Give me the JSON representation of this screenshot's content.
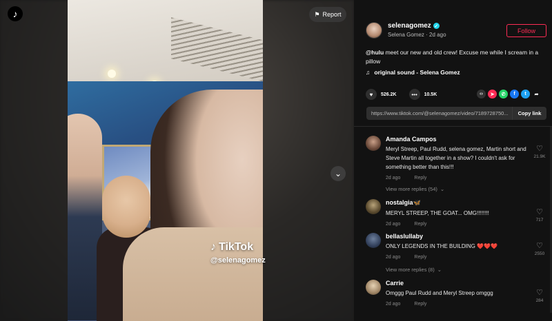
{
  "video": {
    "report_label": "Report",
    "watermark_brand": "TikTok",
    "watermark_handle": "@selenagomez"
  },
  "author": {
    "username": "selenagomez",
    "display_name": "Selena Gomez",
    "time": "2d ago",
    "follow_label": "Follow"
  },
  "caption": {
    "mention": "@hulu",
    "text": " meet our new and old crew! Excuse me while I scream in a pillow"
  },
  "sound": {
    "label": "original sound - Selena Gomez"
  },
  "stats": {
    "likes": "526.2K",
    "comments": "10.5K"
  },
  "link": {
    "url": "https://www.tiktok.com/@selenagomez/video/7189728750...",
    "copy_label": "Copy link"
  },
  "comments": [
    {
      "user": "Amanda Campos",
      "text": "Meryl Streep, Paul Rudd, selena gomez, Martin short and Steve Martin all together in a show? I couldn't ask for something better than this!!!",
      "time": "2d ago",
      "reply": "Reply",
      "likes": "21.9K",
      "more_replies": "View more replies (54)"
    },
    {
      "user": "nostalgia🦋",
      "text": "MERYL STREEP, THE GOAT... OMG!!!!!!!!",
      "time": "2d ago",
      "reply": "Reply",
      "likes": "717"
    },
    {
      "user": "bellaslullaby",
      "text": "ONLY LEGENDS IN THE BUILDING ❤️❤️❤️",
      "time": "2d ago",
      "reply": "Reply",
      "likes": "2550",
      "more_replies": "View more replies (8)"
    },
    {
      "user": "Carrie",
      "text": "Omggg Paul Rudd and Meryl Streep omggg",
      "time": "2d ago",
      "reply": "Reply",
      "likes": "284"
    }
  ],
  "colors": {
    "accent": "#fe2c55",
    "verified": "#20d5ec",
    "panel_bg": "#121212"
  }
}
